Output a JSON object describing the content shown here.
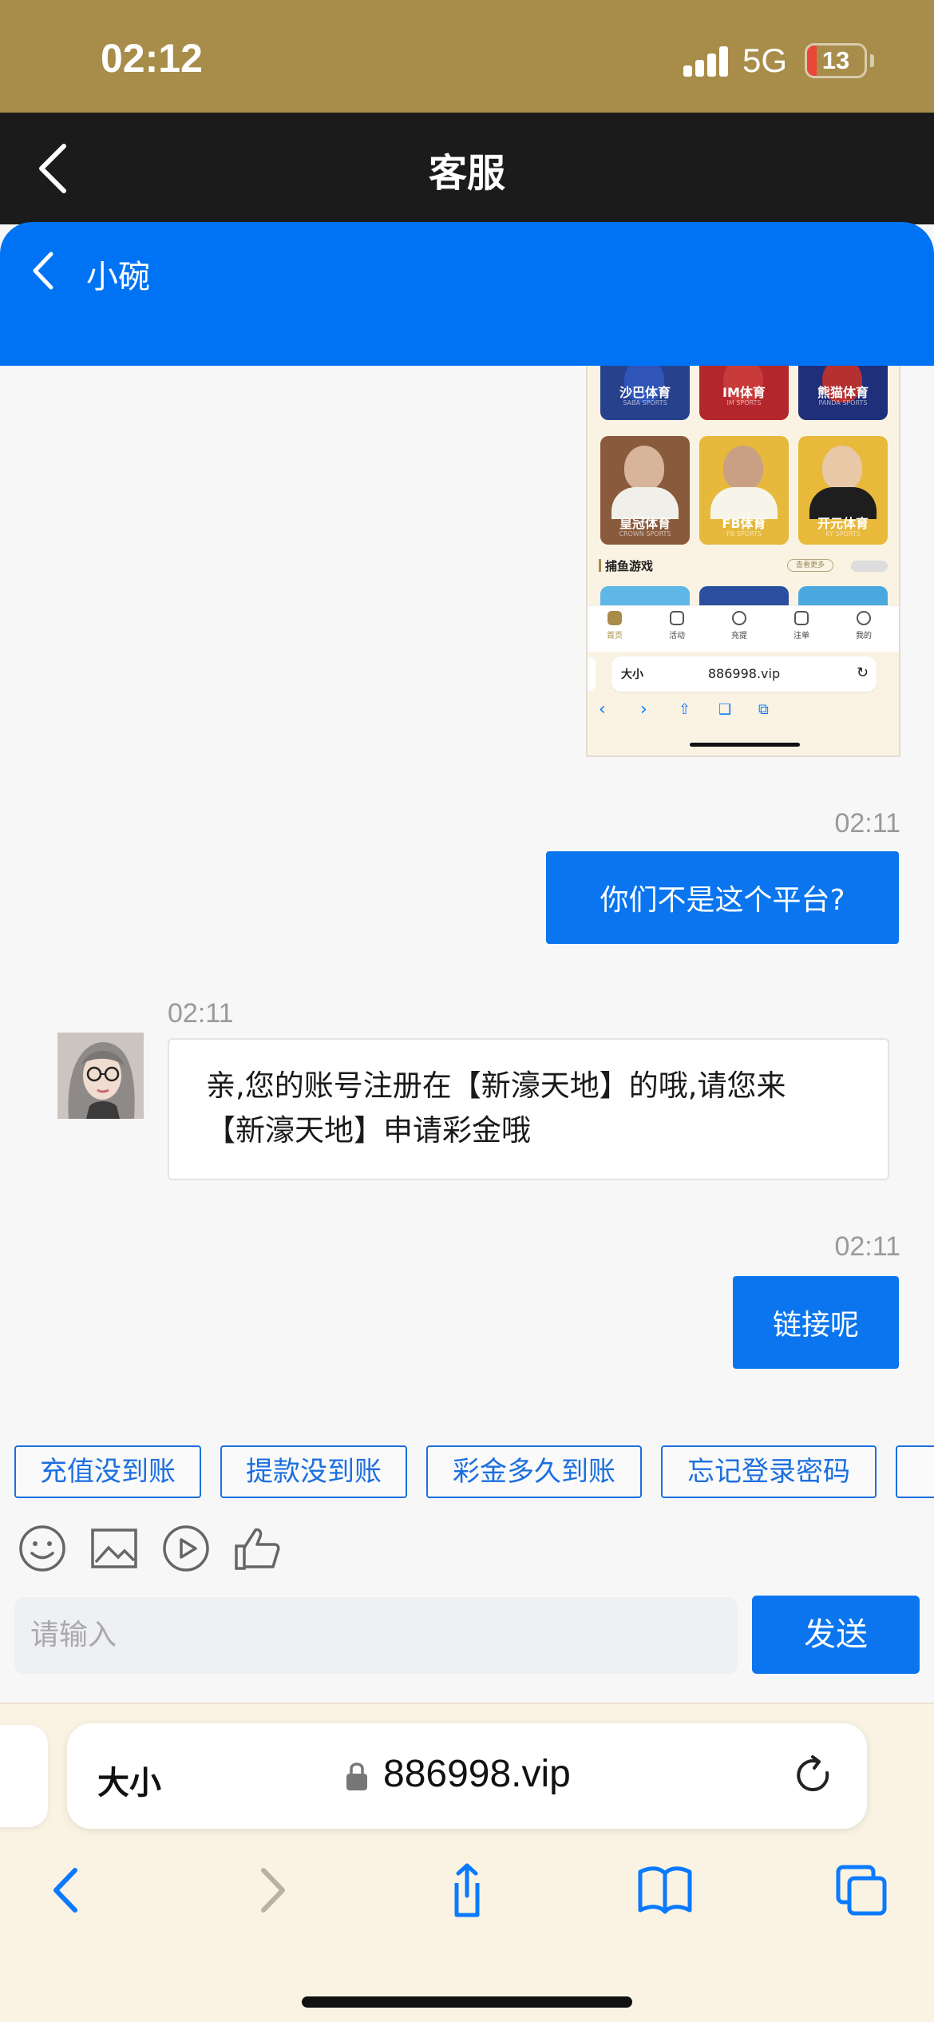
{
  "status_bar": {
    "time": "02:12",
    "network": "5G",
    "battery": "13"
  },
  "nav": {
    "title": "客服"
  },
  "chat_header": {
    "agent_name": "小碗"
  },
  "screenshot_preview": {
    "sports_tiles_row1": [
      {
        "label": "沙巴体育",
        "sub": "SABA SPORTS"
      },
      {
        "label": "IM体育",
        "sub": "IM SPORTS"
      },
      {
        "label": "熊猫体育",
        "sub": "PANDA SPORTS"
      }
    ],
    "sports_tiles_row2": [
      {
        "label": "皇冠体育",
        "sub": "CROWN SPORTS"
      },
      {
        "label": "FB体育",
        "sub": "FB SPORTS"
      },
      {
        "label": "开元体育",
        "sub": "KY SPORTS"
      }
    ],
    "section_title": "捕鱼游戏",
    "more_label": "查看更多",
    "tabbar": [
      "首页",
      "活动",
      "充提",
      "注单",
      "我的"
    ],
    "url": {
      "size_label": "大小",
      "host": "886998.vip"
    }
  },
  "messages": [
    {
      "side": "out",
      "time": "02:11",
      "text": "你们不是这个平台?"
    },
    {
      "side": "in",
      "time": "02:11",
      "lines": [
        "亲,您的账号注册在【新濠天地】的哦,请您来",
        "【新濠天地】申请彩金哦"
      ]
    },
    {
      "side": "out",
      "time": "02:11",
      "text": "链接呢"
    }
  ],
  "quick_replies": [
    "充值没到账",
    "提款没到账",
    "彩金多久到账",
    "忘记登录密码"
  ],
  "toolbar_icons": [
    "emoji-icon",
    "image-icon",
    "video-icon",
    "thumbs-up-icon"
  ],
  "composer": {
    "placeholder": "请输入",
    "send_label": "发送"
  },
  "browser": {
    "size_label": "大小",
    "host": "886998.vip"
  },
  "colors": {
    "status_bar": "#a88c4a",
    "nav_bar": "#1b1b1b",
    "accent_blue": "#0073f5",
    "browser_bg": "#faf3e3"
  }
}
